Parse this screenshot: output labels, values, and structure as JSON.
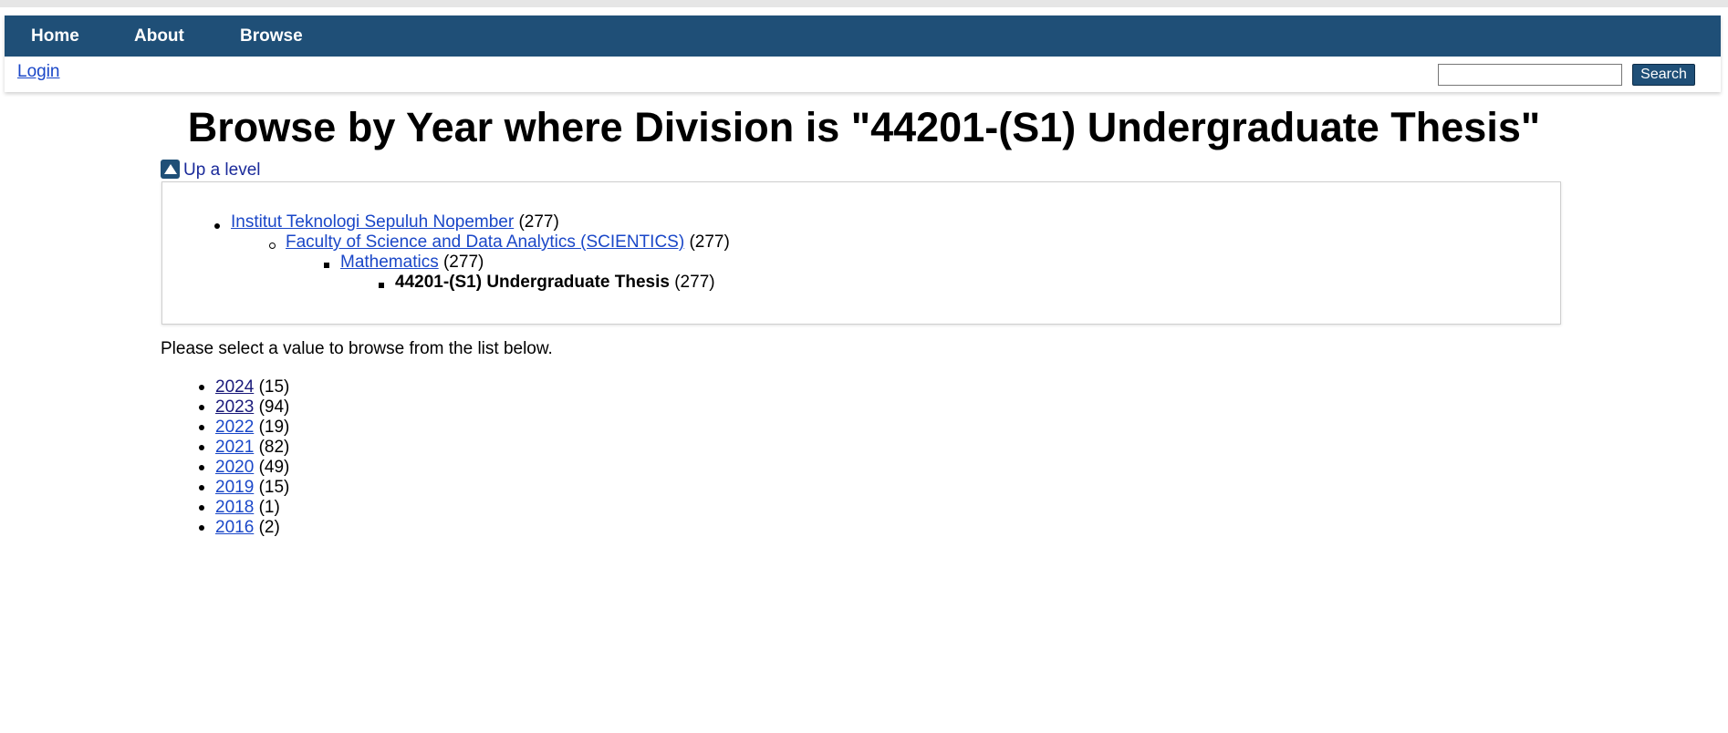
{
  "nav": {
    "items": [
      {
        "label": "Home"
      },
      {
        "label": "About"
      },
      {
        "label": "Browse"
      }
    ]
  },
  "login_label": "Login",
  "search": {
    "placeholder": "",
    "value": "",
    "button_label": "Search"
  },
  "page_title": "Browse by Year where Division is \"44201-(S1) Undergraduate Thesis\"",
  "up_level_label": "Up a level",
  "hierarchy": [
    {
      "label": "Institut Teknologi Sepuluh Nopember",
      "count": "(277)",
      "link": true
    },
    {
      "label": "Faculty of Science and Data Analytics (SCIENTICS)",
      "count": "(277)",
      "link": true
    },
    {
      "label": "Mathematics",
      "count": "(277)",
      "link": true
    },
    {
      "label": "44201-(S1) Undergraduate Thesis",
      "count": "(277)",
      "link": false
    }
  ],
  "instruction": "Please select a value to browse from the list below.",
  "years": [
    {
      "year": "2024",
      "count": "(15)"
    },
    {
      "year": "2023",
      "count": "(94)"
    },
    {
      "year": "2022",
      "count": "(19)"
    },
    {
      "year": "2021",
      "count": "(82)"
    },
    {
      "year": "2020",
      "count": "(49)"
    },
    {
      "year": "2019",
      "count": "(15)"
    },
    {
      "year": "2018",
      "count": "(1)"
    },
    {
      "year": "2016",
      "count": "(2)"
    }
  ],
  "colors": {
    "nav_bg": "#1f4f77",
    "link": "#1a47c8"
  }
}
